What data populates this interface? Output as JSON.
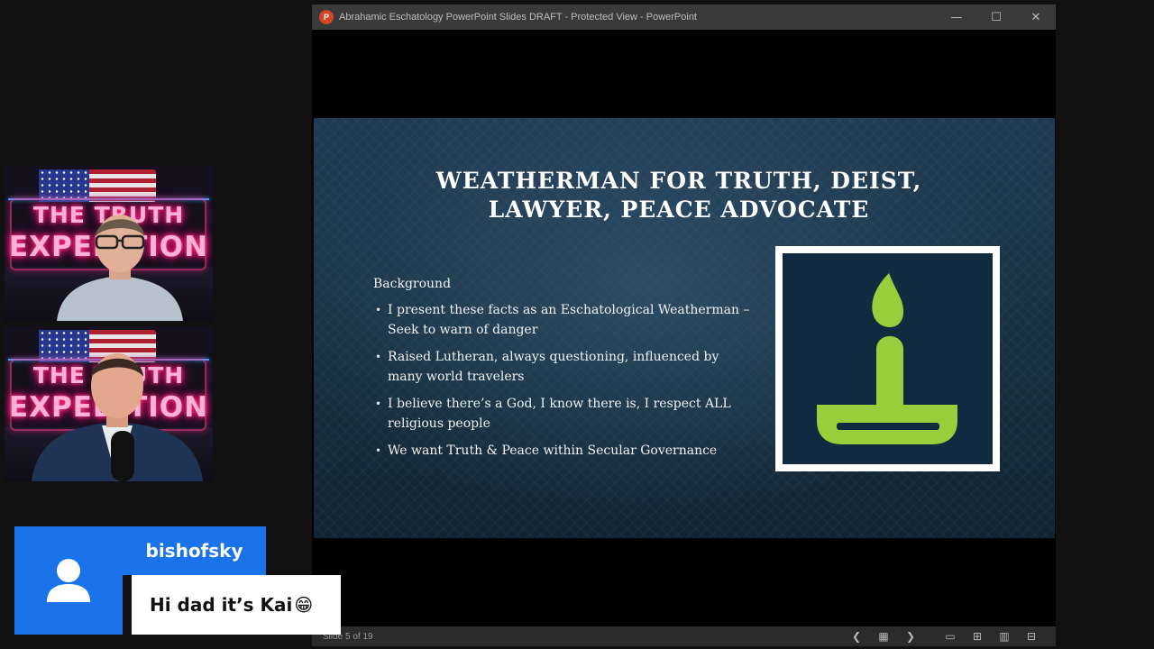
{
  "powerpoint": {
    "window_title": "Abrahamic Eschatology PowerPoint Slides DRAFT  -  Protected View  -  PowerPoint",
    "app_icon": "powerpoint-icon",
    "controls": [
      "minimize-icon",
      "maximize-icon",
      "close-icon"
    ],
    "slide": {
      "title_line1": "WEATHERMAN FOR TRUTH, DEIST,",
      "title_line2": "LAWYER, PEACE ADVOCATE",
      "heading": "Background",
      "bullets": [
        "I present these facts as an Eschatological Weatherman – Seek to warn of danger",
        "Raised Lutheran, always questioning, influenced by many world travelers",
        "I believe there’s a God, I know there is, I respect ALL religious people",
        "We want Truth & Peace within Secular Governance"
      ],
      "image_icon": "candle-icon",
      "colors": {
        "icon_green": "#9acd3c",
        "frame": "#ffffff",
        "background": "#1b3448"
      }
    },
    "status": {
      "slide_counter": "Slide 5 of 19",
      "icons": [
        "previous-slide-icon",
        "slide-menu-icon",
        "next-slide-icon",
        "normal-view-icon",
        "slide-sorter-icon",
        "reading-view-icon",
        "slideshow-icon"
      ]
    }
  },
  "webcams": {
    "sign_line1": "THE TRUTH",
    "sign_line2": "EXPEDITION",
    "feeds": [
      "host-1",
      "host-2"
    ]
  },
  "chat": {
    "avatar_icon": "user-avatar-icon",
    "username": "bishofsky",
    "message": "Hi dad it’s Kai",
    "emoji": "😁",
    "accent": "#1a73e8"
  }
}
